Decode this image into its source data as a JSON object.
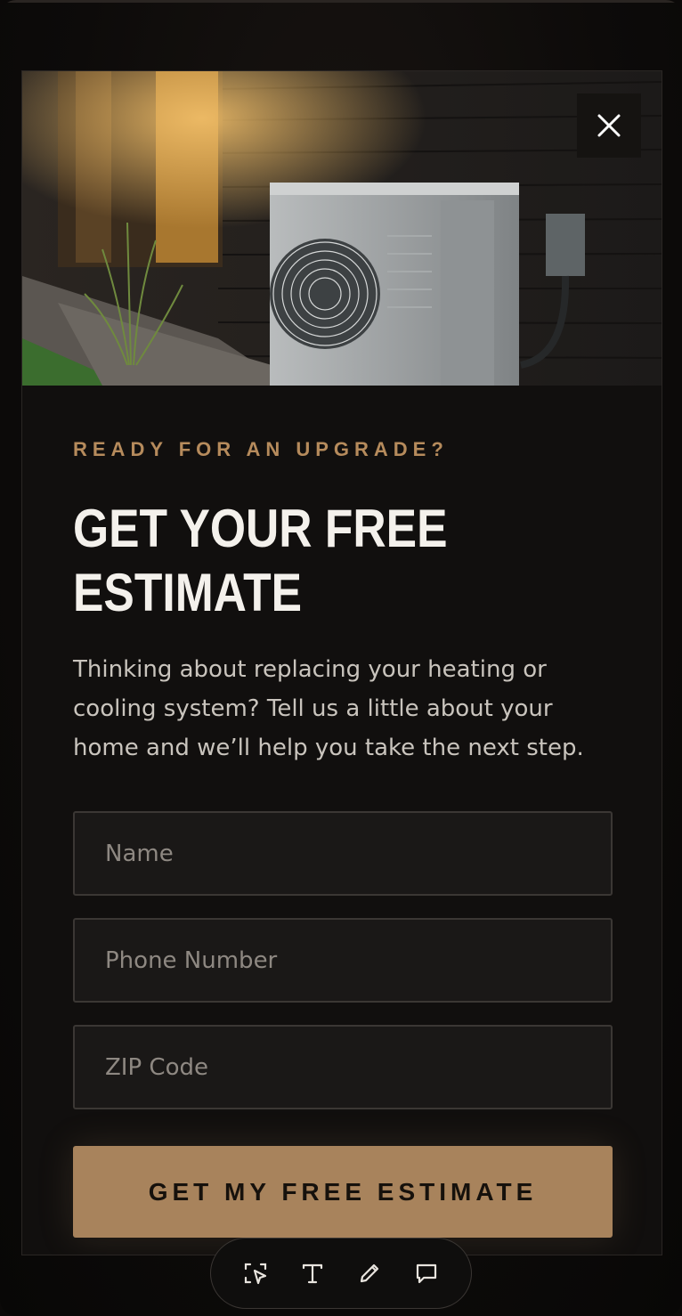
{
  "modal": {
    "eyebrow": "READY FOR AN UPGRADE?",
    "headline_line1": "GET YOUR FREE",
    "headline_line2": "ESTIMATE",
    "description": "Thinking about replacing your heating or cooling system? Tell us a little about your home and we’ll help you take the next step.",
    "close_icon": "close-icon",
    "hero_image": "outdoor-ac-unit-photo"
  },
  "form": {
    "name_placeholder": "Name",
    "phone_placeholder": "Phone Number",
    "zip_placeholder": "ZIP Code",
    "submit_label": "GET MY FREE ESTIMATE"
  },
  "toolbar": {
    "tools": [
      "select-icon",
      "text-icon",
      "pencil-icon",
      "comment-icon"
    ]
  },
  "colors": {
    "accent": "#a8835c",
    "eyebrow": "#b68b5c",
    "background": "#110f0e",
    "headline": "#f4f1ec"
  }
}
